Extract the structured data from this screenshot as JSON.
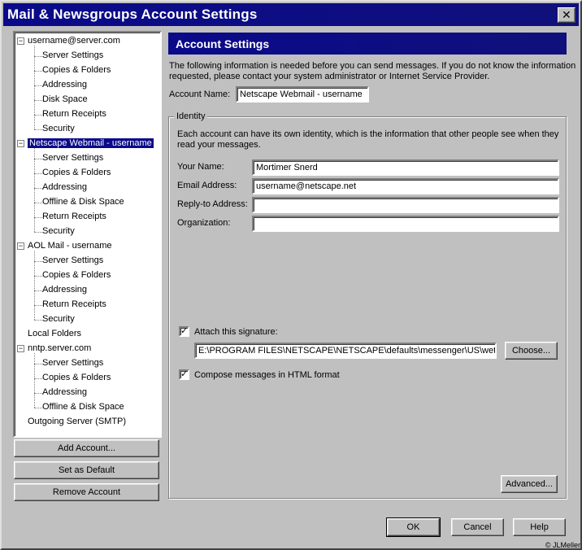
{
  "window": {
    "title": "Mail & Newsgroups Account Settings",
    "close_glyph": "✕"
  },
  "tree": [
    {
      "label": "username@server.com",
      "level": 0,
      "expander": "−"
    },
    {
      "label": "Server Settings",
      "level": 1
    },
    {
      "label": "Copies & Folders",
      "level": 1
    },
    {
      "label": "Addressing",
      "level": 1
    },
    {
      "label": "Disk Space",
      "level": 1
    },
    {
      "label": "Return Receipts",
      "level": 1
    },
    {
      "label": "Security",
      "level": 1
    },
    {
      "label": "Netscape Webmail - username",
      "level": 0,
      "expander": "−",
      "selected": true
    },
    {
      "label": "Server Settings",
      "level": 1
    },
    {
      "label": "Copies & Folders",
      "level": 1
    },
    {
      "label": "Addressing",
      "level": 1
    },
    {
      "label": "Offline & Disk Space",
      "level": 1
    },
    {
      "label": "Return Receipts",
      "level": 1
    },
    {
      "label": "Security",
      "level": 1
    },
    {
      "label": "AOL Mail - username",
      "level": 0,
      "expander": "−"
    },
    {
      "label": "Server Settings",
      "level": 1
    },
    {
      "label": "Copies & Folders",
      "level": 1
    },
    {
      "label": "Addressing",
      "level": 1
    },
    {
      "label": "Return Receipts",
      "level": 1
    },
    {
      "label": "Security",
      "level": 1
    },
    {
      "label": "Local Folders",
      "level": 0
    },
    {
      "label": "nntp.server.com",
      "level": 0,
      "expander": "−"
    },
    {
      "label": "Server Settings",
      "level": 1
    },
    {
      "label": "Copies & Folders",
      "level": 1
    },
    {
      "label": "Addressing",
      "level": 1
    },
    {
      "label": "Offline & Disk Space",
      "level": 1
    },
    {
      "label": "Outgoing Server (SMTP)",
      "level": 0
    }
  ],
  "left_buttons": {
    "add": "Add Account...",
    "default": "Set as Default",
    "remove": "Remove Account"
  },
  "panel": {
    "title": "Account Settings",
    "intro_line1": "The following information is needed before you can send messages. If you do not know the information",
    "intro_line2": "requested, please contact your system administrator or Internet Service Provider.",
    "account_name_label": "Account Name:",
    "account_name_value": "Netscape Webmail - username",
    "identity_legend": "Identity",
    "identity_line1": "Each account can have its own identity, which is the information that other people see when they",
    "identity_line2": "read your messages.",
    "your_name_label": "Your Name:",
    "your_name_value": "Mortimer Snerd",
    "email_label": "Email Address:",
    "email_value": "username@netscape.net",
    "reply_to_label": "Reply-to Address:",
    "reply_to_value": "",
    "organization_label": "Organization:",
    "organization_value": "",
    "attach_signature_label": "Attach this signature:",
    "attach_signature_checked": true,
    "signature_path": "E:\\PROGRAM FILES\\NETSCAPE\\NETSCAPE\\defaults\\messenger\\US\\wet",
    "choose_label": "Choose...",
    "compose_html_label": "Compose messages in HTML format",
    "compose_html_checked": true,
    "advanced_label": "Advanced...",
    "check_glyph": "✓"
  },
  "footer": {
    "ok": "OK",
    "cancel": "Cancel",
    "help": "Help",
    "copyright": "© JLMeller"
  }
}
